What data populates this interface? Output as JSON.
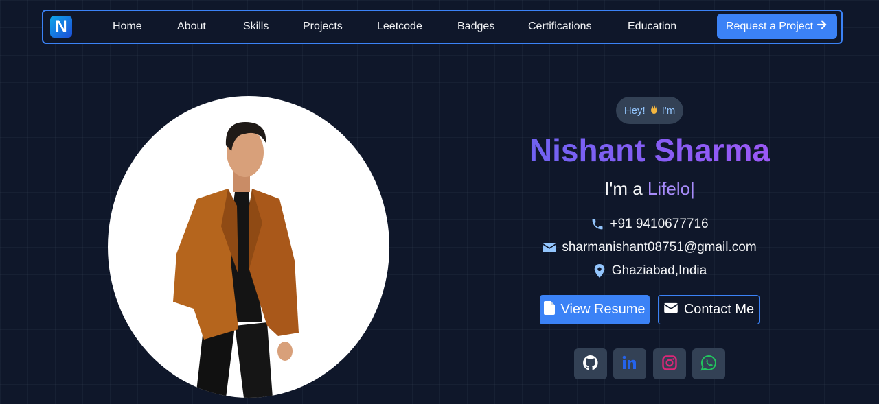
{
  "navbar": {
    "logo_letter": "N",
    "links": [
      "Home",
      "About",
      "Skills",
      "Projects",
      "Leetcode",
      "Badges",
      "Certifications",
      "Education"
    ],
    "request_label": "Request a Project"
  },
  "hero": {
    "greeting": "Hey!",
    "greeting_suffix": "I'm",
    "name": "Nishant Sharma",
    "typed_prefix": "I'm a ",
    "typed_word": "Lifelo",
    "cursor": "|",
    "phone": "+91 9410677716",
    "email": "sharmanishant08751@gmail.com",
    "location": "Ghaziabad,India",
    "resume_label": "View Resume",
    "contact_label": "Contact Me"
  },
  "social": [
    "github-icon",
    "linkedin-icon",
    "instagram-icon",
    "whatsapp-icon"
  ],
  "colors": {
    "background": "#0f172a",
    "accent": "#3b82f6",
    "name_gradient_start": "#6366f1",
    "name_gradient_end": "#a855f7",
    "icon_blue": "#93c5fd",
    "linkedin": "#2563eb",
    "instagram": "#db2777",
    "whatsapp": "#22c55e"
  }
}
